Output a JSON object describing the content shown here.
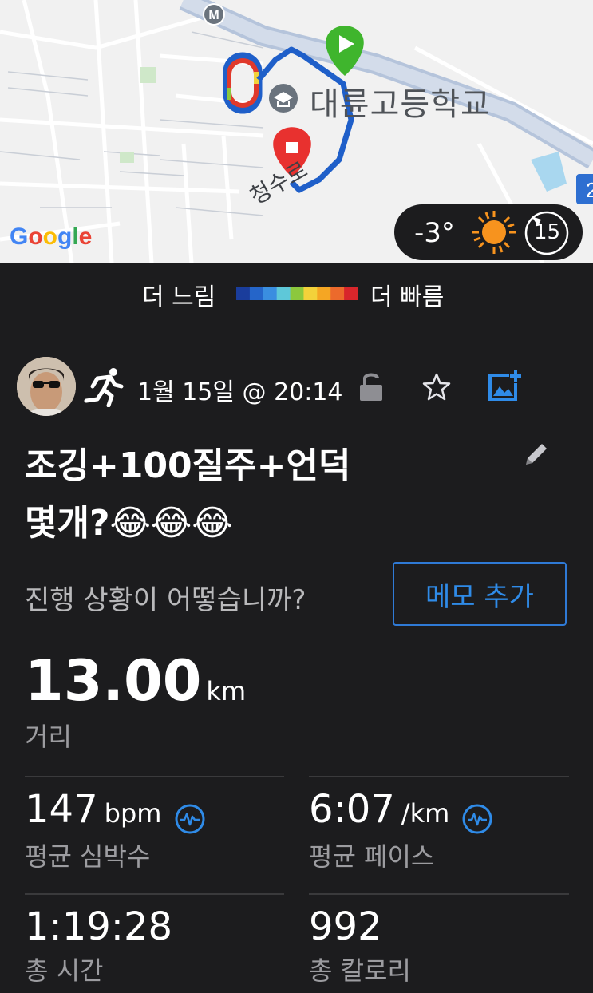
{
  "map": {
    "school_label": "대륜고등학교",
    "road_label": "청수로",
    "google_logo": [
      "G",
      "o",
      "o",
      "g",
      "l",
      "e"
    ],
    "metro_marker": "M",
    "edge_badge": "2"
  },
  "weather": {
    "temperature": "-3°",
    "wind": "15",
    "sun_color": "#f7931e"
  },
  "legend": {
    "slower": "더 느림",
    "faster": "더 빠름",
    "colors": [
      "#1a3d9c",
      "#2565c9",
      "#3a8ee0",
      "#5ec8d9",
      "#8cc83d",
      "#f3d23a",
      "#f5a623",
      "#ec6a2c",
      "#d8262b"
    ]
  },
  "activity": {
    "date": "1월 15일 @ 20:14",
    "title_line1": "조깅+100질주+언덕",
    "title_line2": "몇개?😂😂😂",
    "progress_question": "진행 상황이 어떻습니까?",
    "memo_button": "메모 추가"
  },
  "stats": {
    "distance": {
      "value": "13.00",
      "unit": "km",
      "label": "거리"
    },
    "heart_rate": {
      "value": "147",
      "unit": "bpm",
      "label": "평균 심박수"
    },
    "pace": {
      "value": "6:07",
      "unit": "/km",
      "label": "평균 페이스"
    },
    "total_time": {
      "value": "1:19:28",
      "label": "총 시간"
    },
    "calories": {
      "value": "992",
      "label": "총 칼로리"
    }
  },
  "colors": {
    "accent_blue": "#2f8be8",
    "start_green": "#3fb52d",
    "end_red": "#e8312f",
    "route_blue": "#1f5fc9"
  }
}
